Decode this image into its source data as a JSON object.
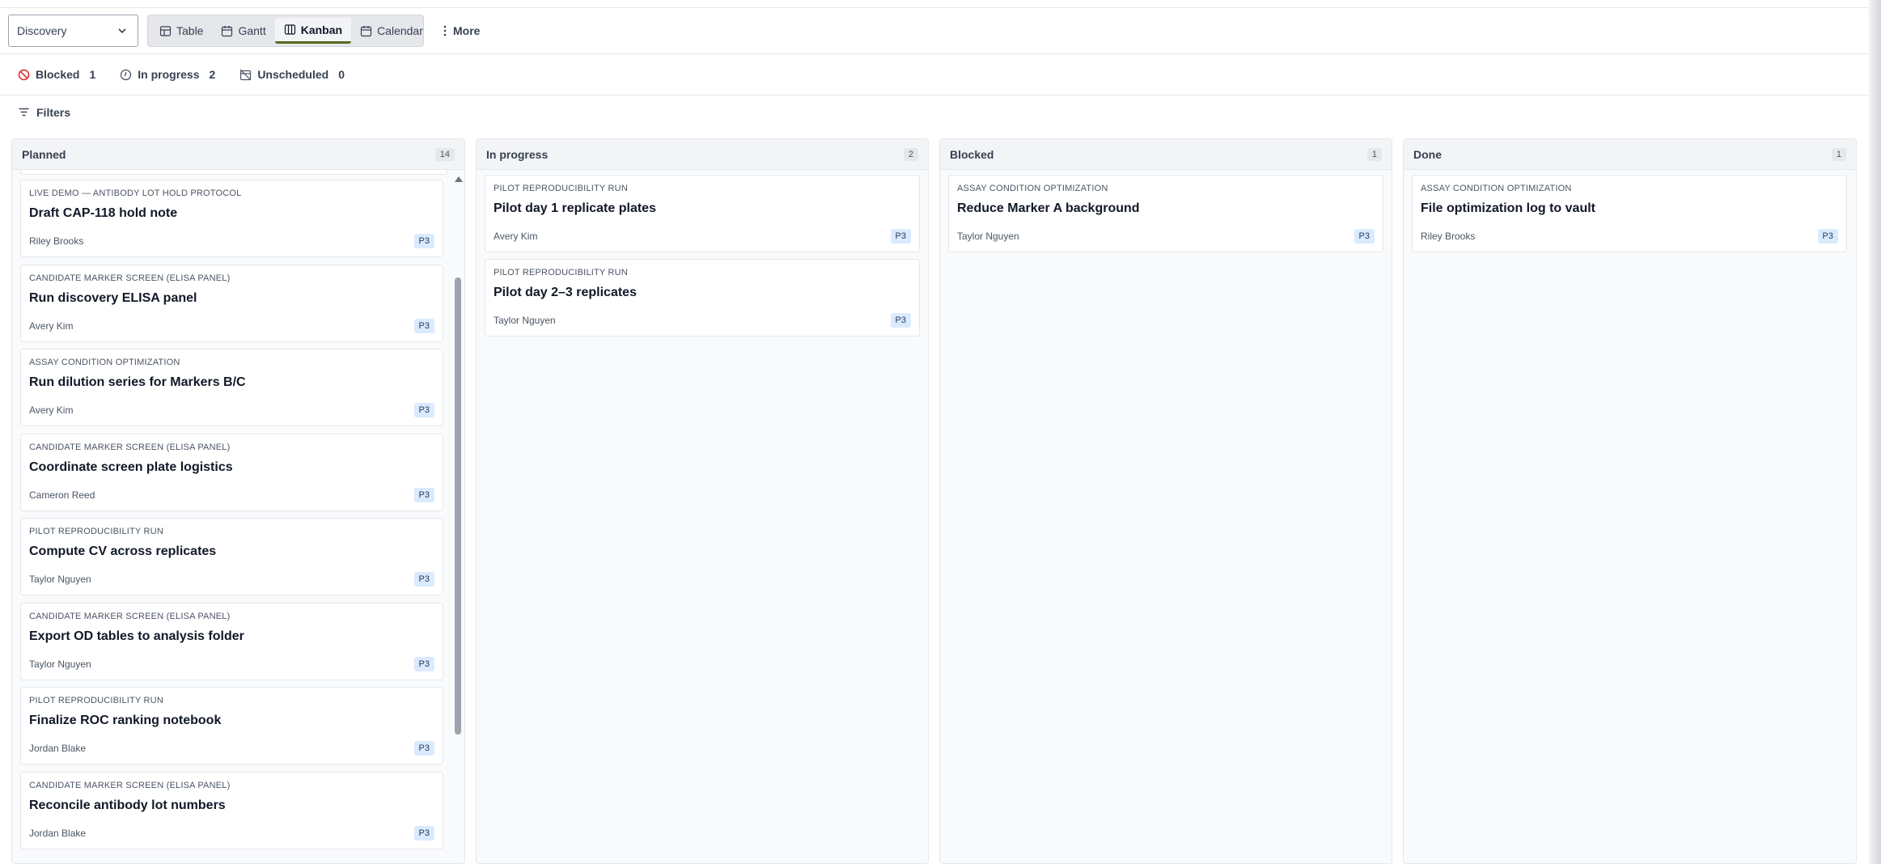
{
  "toolbar": {
    "project_select": "Discovery",
    "views": [
      {
        "label": "Table",
        "icon": "table-icon"
      },
      {
        "label": "Gantt",
        "icon": "calendar-icon"
      },
      {
        "label": "Kanban",
        "icon": "columns-icon",
        "active": true
      },
      {
        "label": "Calendar",
        "icon": "calendar-icon"
      }
    ],
    "more_label": "More"
  },
  "status": {
    "blocked_label": "Blocked",
    "blocked_count": "1",
    "in_progress_label": "In progress",
    "in_progress_count": "2",
    "unscheduled_label": "Unscheduled",
    "unscheduled_count": "0"
  },
  "filters_label": "Filters",
  "colors": {
    "active_tab_underline": "#556b1f",
    "blocked_icon": "#dc2626",
    "priority_badge_bg": "#dbeafe"
  },
  "columns": [
    {
      "title": "Planned",
      "count": "14",
      "cards": [
        {
          "project": "LIVE DEMO — ANTIBODY LOT HOLD PROTOCOL",
          "title": "Draft CAP-118 hold note",
          "assignee": "Riley Brooks",
          "priority": "P3"
        },
        {
          "project": "CANDIDATE MARKER SCREEN (ELISA PANEL)",
          "title": "Run discovery ELISA panel",
          "assignee": "Avery Kim",
          "priority": "P3"
        },
        {
          "project": "ASSAY CONDITION OPTIMIZATION",
          "title": "Run dilution series for Markers B/C",
          "assignee": "Avery Kim",
          "priority": "P3"
        },
        {
          "project": "CANDIDATE MARKER SCREEN (ELISA PANEL)",
          "title": "Coordinate screen plate logistics",
          "assignee": "Cameron Reed",
          "priority": "P3"
        },
        {
          "project": "PILOT REPRODUCIBILITY RUN",
          "title": "Compute CV across replicates",
          "assignee": "Taylor Nguyen",
          "priority": "P3"
        },
        {
          "project": "CANDIDATE MARKER SCREEN (ELISA PANEL)",
          "title": "Export OD tables to analysis folder",
          "assignee": "Taylor Nguyen",
          "priority": "P3"
        },
        {
          "project": "PILOT REPRODUCIBILITY RUN",
          "title": "Finalize ROC ranking notebook",
          "assignee": "Jordan Blake",
          "priority": "P3"
        },
        {
          "project": "CANDIDATE MARKER SCREEN (ELISA PANEL)",
          "title": "Reconcile antibody lot numbers",
          "assignee": "Jordan Blake",
          "priority": "P3"
        }
      ]
    },
    {
      "title": "In progress",
      "count": "2",
      "cards": [
        {
          "project": "PILOT REPRODUCIBILITY RUN",
          "title": "Pilot day 1 replicate plates",
          "assignee": "Avery Kim",
          "priority": "P3"
        },
        {
          "project": "PILOT REPRODUCIBILITY RUN",
          "title": "Pilot day 2–3 replicates",
          "assignee": "Taylor Nguyen",
          "priority": "P3"
        }
      ]
    },
    {
      "title": "Blocked",
      "count": "1",
      "cards": [
        {
          "project": "ASSAY CONDITION OPTIMIZATION",
          "title": "Reduce Marker A background",
          "assignee": "Taylor Nguyen",
          "priority": "P3"
        }
      ]
    },
    {
      "title": "Done",
      "count": "1",
      "cards": [
        {
          "project": "ASSAY CONDITION OPTIMIZATION",
          "title": "File optimization log to vault",
          "assignee": "Riley Brooks",
          "priority": "P3"
        }
      ]
    }
  ]
}
